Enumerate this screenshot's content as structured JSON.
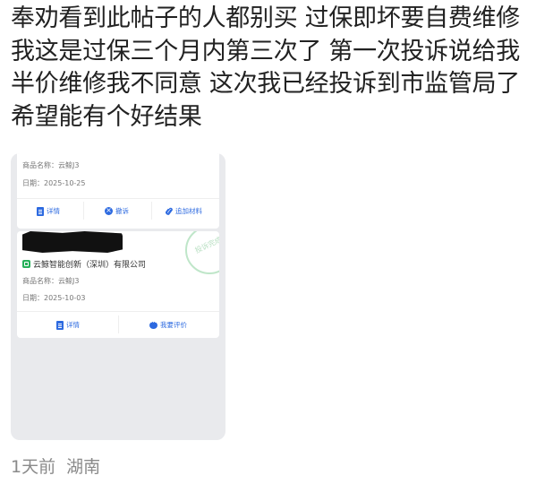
{
  "post": {
    "lines": [
      "奉劝看到此帖子的人都别买 过保即坏要自费维修",
      "我这是过保三个月内第三次了 第一次投诉说给我",
      "半价维修我不同意 这次我已经投诉到市监管局了",
      "希望能有个好结果"
    ]
  },
  "screenshot": {
    "card1": {
      "product": "商品名称：云鲸J3",
      "date": "日期：2025-10-25",
      "actions": {
        "detail": "详情",
        "revoke": "撤诉",
        "add_material": "追加材料"
      }
    },
    "card2": {
      "seal_text": "投诉完成",
      "store": "云鲸智能创新（深圳）有限公司",
      "product": "商品名称：云鲸J3",
      "date": "日期：2025-10-03",
      "actions": {
        "detail": "详情",
        "review": "我要评价"
      }
    }
  },
  "meta": {
    "time": "1天前",
    "location": "湖南"
  },
  "colors": {
    "accent": "#2d6ae0",
    "store_green": "#27b05a"
  }
}
